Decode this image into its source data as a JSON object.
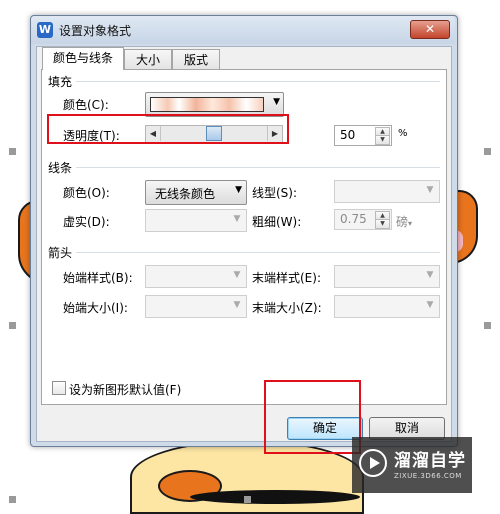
{
  "dialog": {
    "title": "设置对象格式",
    "close_glyph": "✕",
    "app_icon_letter": "W"
  },
  "tabs": [
    {
      "label": "颜色与线条",
      "active": true
    },
    {
      "label": "大小",
      "active": false
    },
    {
      "label": "版式",
      "active": false
    }
  ],
  "fill": {
    "section_label": "填充",
    "color_label": "颜色(C):",
    "transparency_label": "透明度(T):",
    "transparency_value": "50",
    "transparency_unit": "%",
    "transparency_level": 0.5
  },
  "line": {
    "section_label": "线条",
    "color_label": "颜色(O):",
    "color_value": "无线条颜色",
    "style_label": "线型(S):",
    "dash_label": "虚实(D):",
    "weight_label": "粗细(W):",
    "weight_value": "0.75",
    "weight_unit": "磅"
  },
  "arrows": {
    "section_label": "箭头",
    "begin_style_label": "始端样式(B):",
    "end_style_label": "末端样式(E):",
    "begin_size_label": "始端大小(I):",
    "end_size_label": "末端大小(Z):"
  },
  "default_checkbox_label": "设为新图形默认值(F)",
  "buttons": {
    "ok": "确定",
    "cancel": "取消"
  },
  "watermark": {
    "name": "溜溜自学",
    "url": "ZIXUE.3D66.COM"
  },
  "colors": {
    "highlight_red": "#e0101a",
    "accent_blue": "#3c7fb1"
  }
}
